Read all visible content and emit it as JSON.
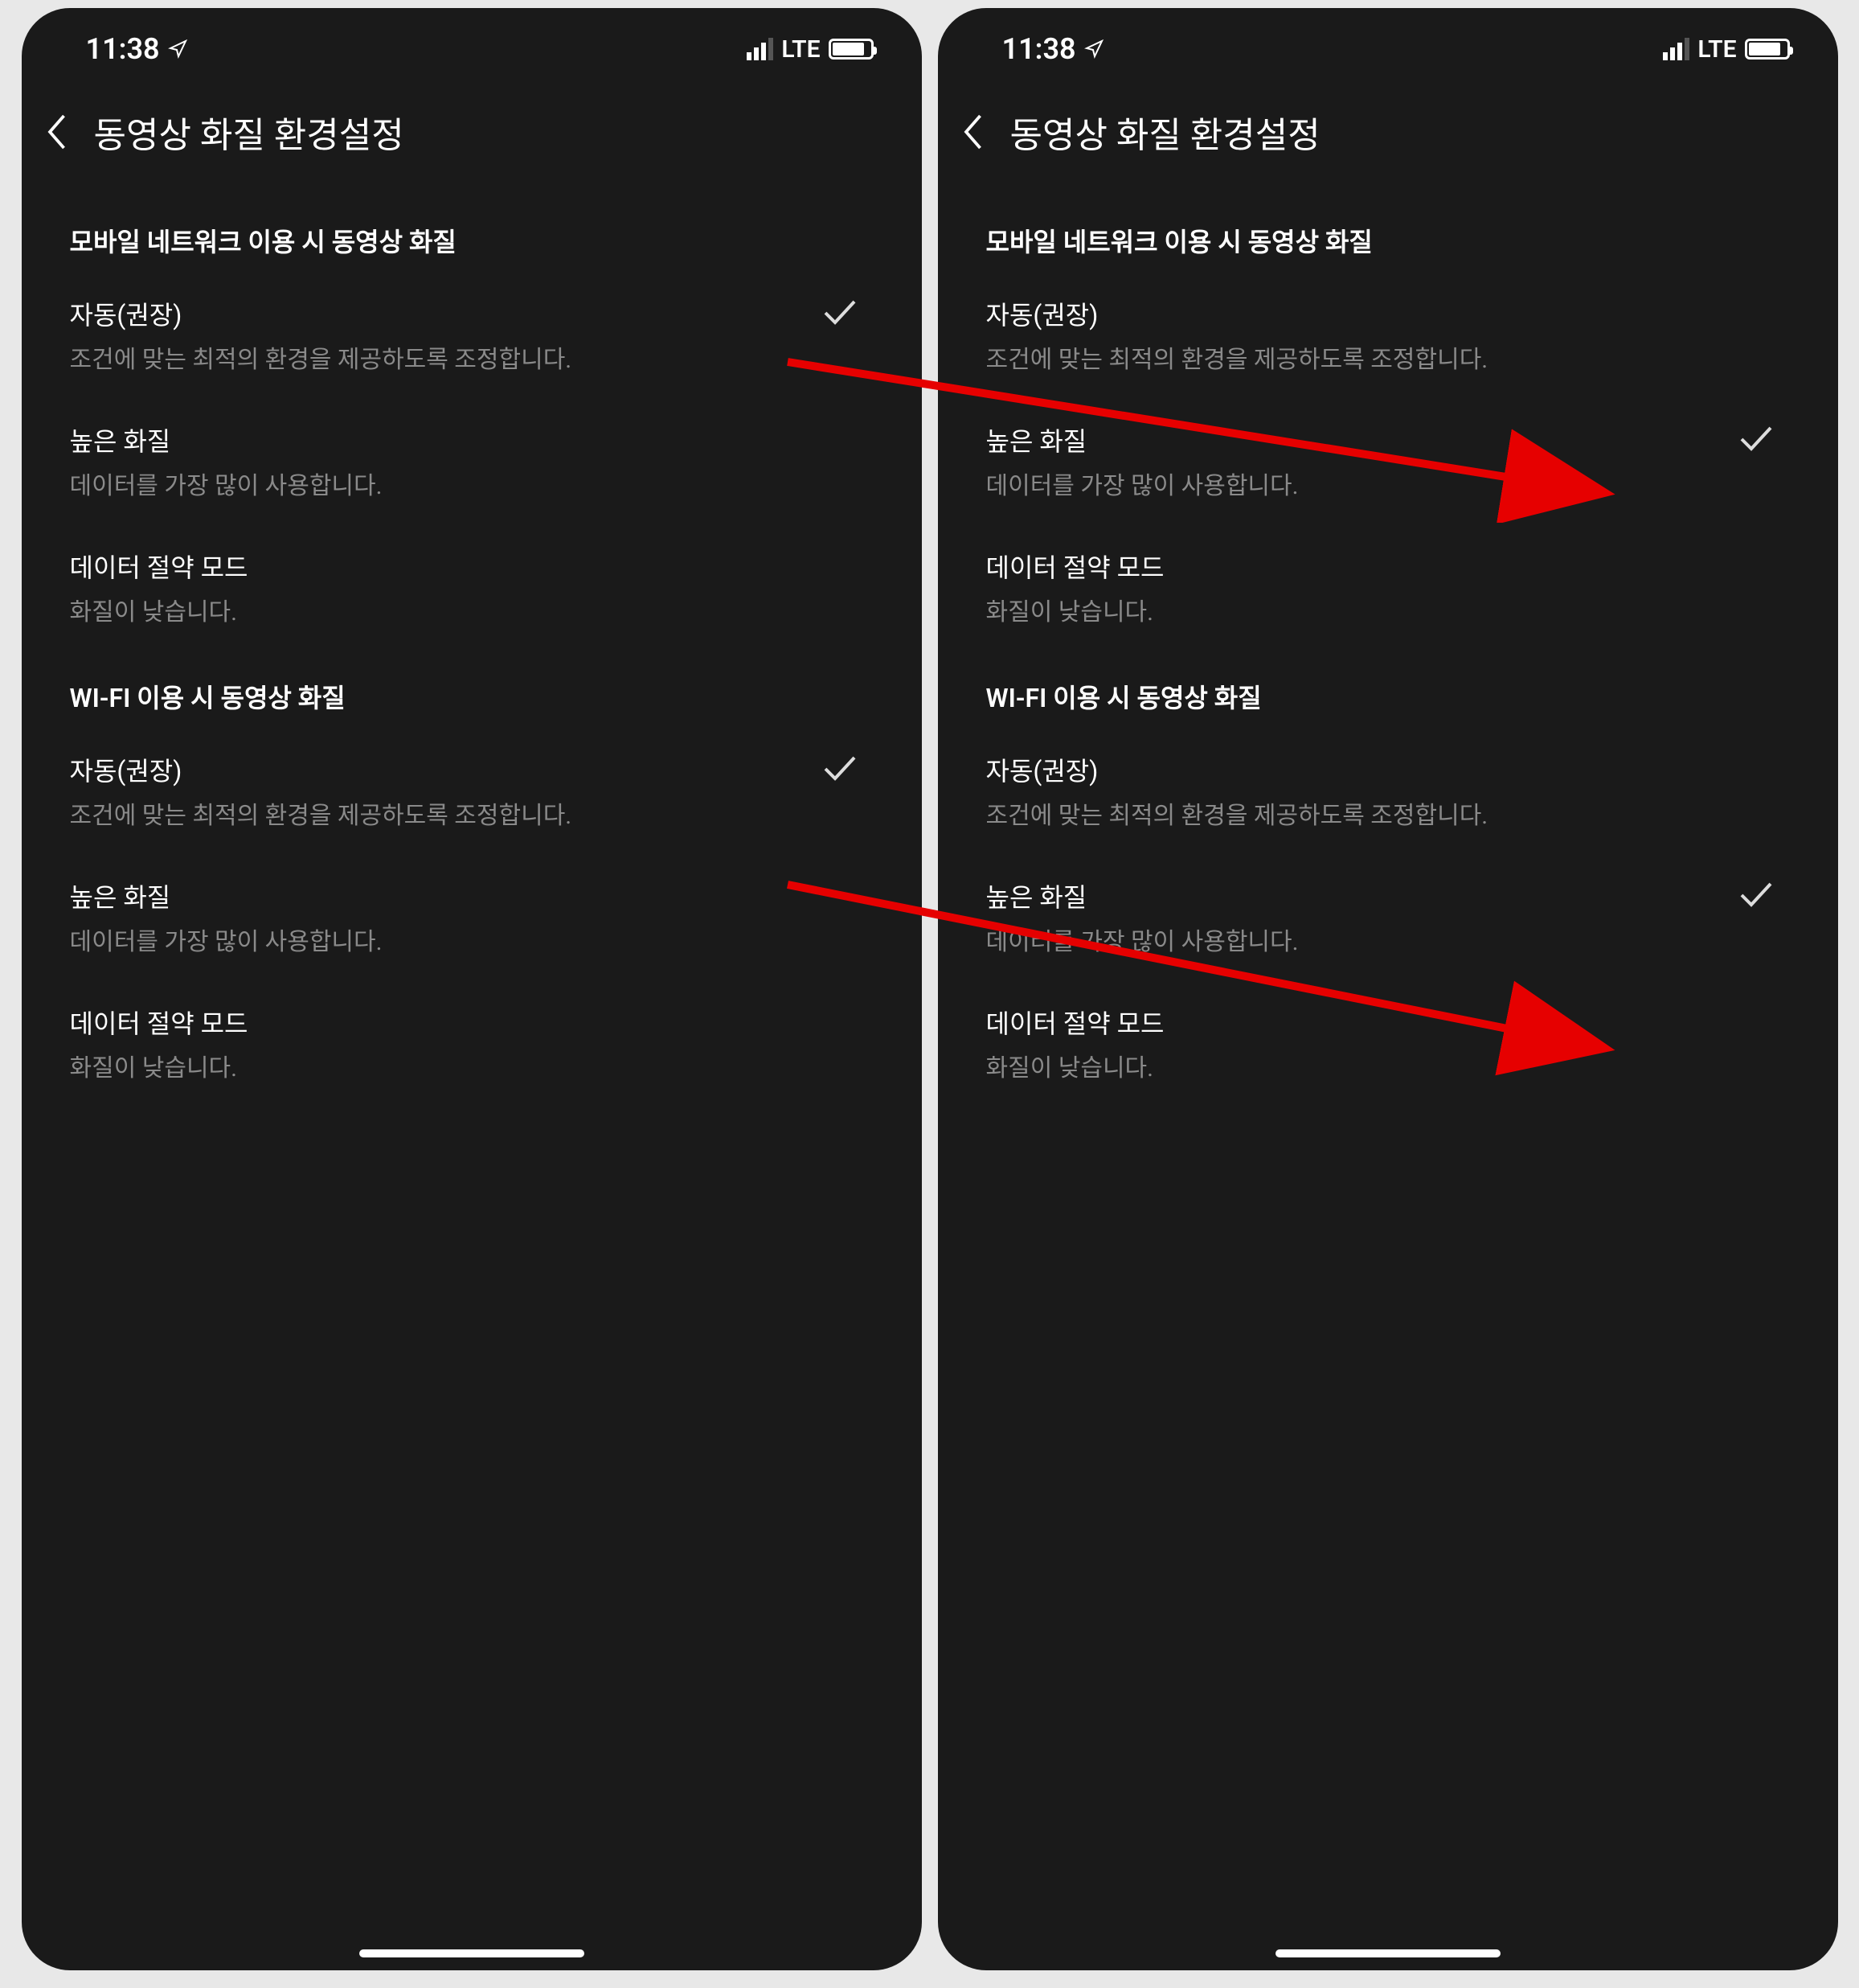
{
  "status": {
    "time": "11:38",
    "network": "LTE"
  },
  "header": {
    "title": "동영상 화질 환경설정"
  },
  "sections": {
    "mobile": {
      "header": "모바일 네트워크 이용 시 동영상 화질",
      "auto": {
        "title": "자동(권장)",
        "desc": "조건에 맞는 최적의 환경을 제공하도록 조정합니다."
      },
      "high": {
        "title": "높은 화질",
        "desc": "데이터를 가장 많이 사용합니다."
      },
      "saver": {
        "title": "데이터 절약 모드",
        "desc": "화질이 낮습니다."
      }
    },
    "wifi": {
      "header": "WI-FI 이용 시 동영상 화질",
      "auto": {
        "title": "자동(권장)",
        "desc": "조건에 맞는 최적의 환경을 제공하도록 조정합니다."
      },
      "high": {
        "title": "높은 화질",
        "desc": "데이터를 가장 많이 사용합니다."
      },
      "saver": {
        "title": "데이터 절약 모드",
        "desc": "화질이 낮습니다."
      }
    }
  },
  "screens": {
    "left": {
      "mobile_selected": "auto",
      "wifi_selected": "auto"
    },
    "right": {
      "mobile_selected": "high",
      "wifi_selected": "high"
    }
  }
}
